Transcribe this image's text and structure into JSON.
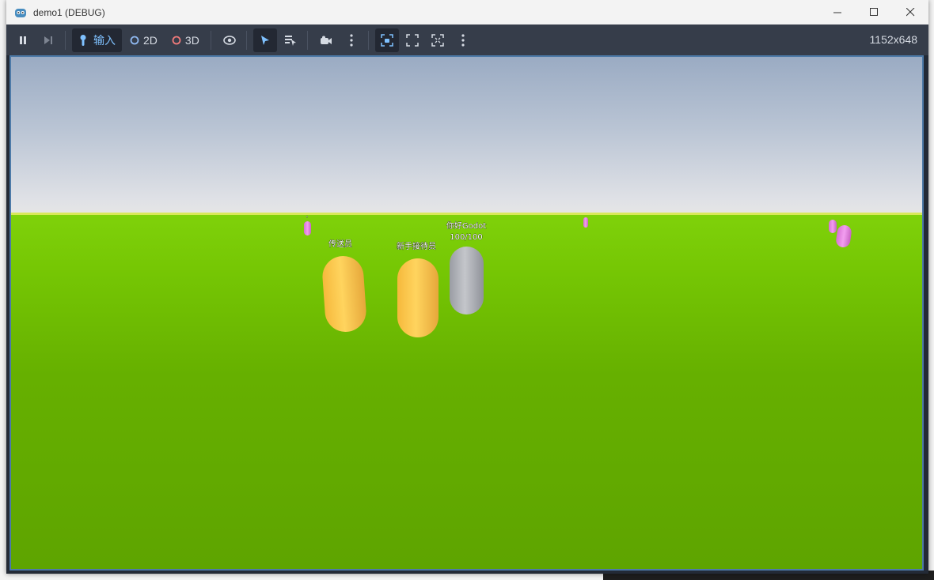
{
  "window": {
    "title": "demo1 (DEBUG)"
  },
  "toolbar": {
    "input_label": "输入",
    "mode_2d": "2D",
    "mode_3d": "3D",
    "resolution": "1152x648"
  },
  "scene": {
    "npc_teleporter": "传送员",
    "npc_receptionist": "新手接待员",
    "player_name": "你好Godot",
    "player_health": "100/100"
  },
  "colors": {
    "accent_blue": "#7fc1ff",
    "npc_yellow": "#f7c84c",
    "player_gray": "#a9acb3",
    "enemy_pink": "#e47fe0",
    "ground_green": "#6ab800"
  },
  "icons": [
    "godot-icon",
    "minimize-icon",
    "maximize-icon",
    "close-icon",
    "pause-icon",
    "next-frame-icon",
    "input-icon",
    "2d-icon",
    "3d-icon",
    "eye-icon",
    "select-icon",
    "list-select-icon",
    "camera-icon",
    "more-icon",
    "camera-override-icon",
    "expand-icon",
    "fullscreen-icon"
  ]
}
